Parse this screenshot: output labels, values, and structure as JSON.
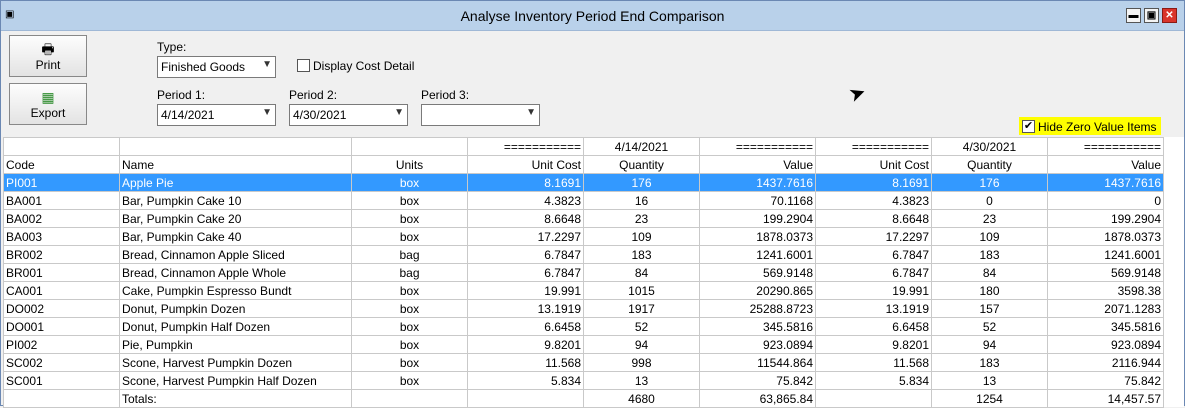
{
  "window": {
    "title": "Analyse Inventory Period End Comparison",
    "controls": {
      "minimize": "▬",
      "maximize": "▣",
      "close": "✕"
    }
  },
  "toolbar": {
    "print_label": "Print",
    "print_icon": "printer-icon",
    "export_label": "Export",
    "export_icon": "spreadsheet-icon"
  },
  "filters": {
    "type_label": "Type:",
    "type_value": "Finished Goods",
    "display_cost_detail_label": "Display Cost Detail",
    "display_cost_detail_checked": false,
    "period1_label": "Period 1:",
    "period1_value": "4/14/2021",
    "period2_label": "Period 2:",
    "period2_value": "4/30/2021",
    "period3_label": "Period 3:",
    "period3_value": "",
    "hide_zero_label": "Hide Zero Value Items",
    "hide_zero_checked": true,
    "hide_zero_highlight": "#ffff00"
  },
  "grid": {
    "top_header": [
      "",
      "",
      "",
      "===========",
      "4/14/2021",
      "===========",
      "===========",
      "4/30/2021",
      "==========="
    ],
    "columns": [
      "Code",
      "Name",
      "Units",
      "Unit Cost",
      "Quantity",
      "Value",
      "Unit Cost",
      "Quantity",
      "Value"
    ],
    "selected_color": "#3399ff",
    "rows": [
      [
        "PI001",
        "Apple Pie",
        "box",
        "8.1691",
        "176",
        "1437.7616",
        "8.1691",
        "176",
        "1437.7616"
      ],
      [
        "BA001",
        "Bar, Pumpkin Cake 10",
        "box",
        "4.3823",
        "16",
        "70.1168",
        "4.3823",
        "0",
        "0"
      ],
      [
        "BA002",
        "Bar, Pumpkin Cake 20",
        "box",
        "8.6648",
        "23",
        "199.2904",
        "8.6648",
        "23",
        "199.2904"
      ],
      [
        "BA003",
        "Bar, Pumpkin Cake 40",
        "box",
        "17.2297",
        "109",
        "1878.0373",
        "17.2297",
        "109",
        "1878.0373"
      ],
      [
        "BR002",
        "Bread, Cinnamon Apple Sliced",
        "bag",
        "6.7847",
        "183",
        "1241.6001",
        "6.7847",
        "183",
        "1241.6001"
      ],
      [
        "BR001",
        "Bread, Cinnamon Apple Whole",
        "bag",
        "6.7847",
        "84",
        "569.9148",
        "6.7847",
        "84",
        "569.9148"
      ],
      [
        "CA001",
        "Cake, Pumpkin Espresso Bundt",
        "box",
        "19.991",
        "1015",
        "20290.865",
        "19.991",
        "180",
        "3598.38"
      ],
      [
        "DO002",
        "Donut, Pumpkin Dozen",
        "box",
        "13.1919",
        "1917",
        "25288.8723",
        "13.1919",
        "157",
        "2071.1283"
      ],
      [
        "DO001",
        "Donut, Pumpkin Half Dozen",
        "box",
        "6.6458",
        "52",
        "345.5816",
        "6.6458",
        "52",
        "345.5816"
      ],
      [
        "PI002",
        "Pie, Pumpkin",
        "box",
        "9.8201",
        "94",
        "923.0894",
        "9.8201",
        "94",
        "923.0894"
      ],
      [
        "SC002",
        "Scone, Harvest Pumpkin Dozen",
        "box",
        "11.568",
        "998",
        "11544.864",
        "11.568",
        "183",
        "2116.944"
      ],
      [
        "SC001",
        "Scone, Harvest Pumpkin Half Dozen",
        "box",
        "5.834",
        "13",
        "75.842",
        "5.834",
        "13",
        "75.842"
      ]
    ],
    "totals": [
      "",
      "Totals:",
      "",
      "",
      "4680",
      "63,865.84",
      "",
      "1254",
      "14,457.57"
    ]
  }
}
